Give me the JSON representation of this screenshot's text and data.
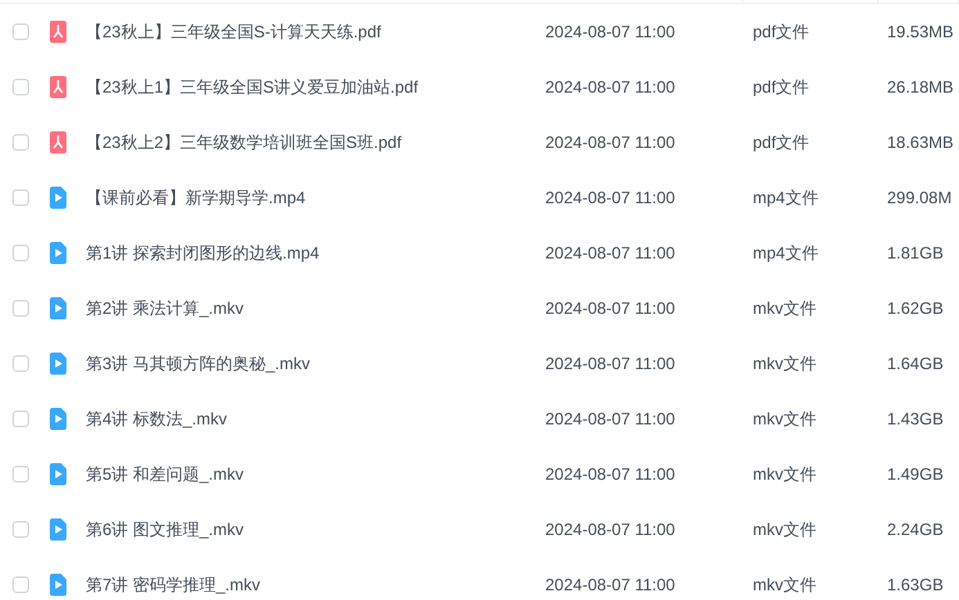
{
  "files": [
    {
      "kind": "pdf",
      "selected": false,
      "name": "【23秋上】三年级全国S-计算天天练.pdf",
      "date": "2024-08-07 11:00",
      "type": "pdf文件",
      "size": "19.53MB"
    },
    {
      "kind": "pdf",
      "selected": false,
      "name": "【23秋上1】三年级全国S讲义爱豆加油站.pdf",
      "date": "2024-08-07 11:00",
      "type": "pdf文件",
      "size": "26.18MB"
    },
    {
      "kind": "pdf",
      "selected": false,
      "name": "【23秋上2】三年级数学培训班全国S班.pdf",
      "date": "2024-08-07 11:00",
      "type": "pdf文件",
      "size": "18.63MB"
    },
    {
      "kind": "video",
      "selected": false,
      "name": "【课前必看】新学期导学.mp4",
      "date": "2024-08-07 11:00",
      "type": "mp4文件",
      "size": "299.08M"
    },
    {
      "kind": "video",
      "selected": false,
      "name": "第1讲 探索封闭图形的边线.mp4",
      "date": "2024-08-07 11:00",
      "type": "mp4文件",
      "size": "1.81GB"
    },
    {
      "kind": "video",
      "selected": false,
      "name": "第2讲 乘法计算_.mkv",
      "date": "2024-08-07 11:00",
      "type": "mkv文件",
      "size": "1.62GB"
    },
    {
      "kind": "video",
      "selected": false,
      "name": "第3讲 马其顿方阵的奥秘_.mkv",
      "date": "2024-08-07 11:00",
      "type": "mkv文件",
      "size": "1.64GB"
    },
    {
      "kind": "video",
      "selected": false,
      "name": "第4讲 标数法_.mkv",
      "date": "2024-08-07 11:00",
      "type": "mkv文件",
      "size": "1.43GB"
    },
    {
      "kind": "video",
      "selected": false,
      "name": "第5讲 和差问题_.mkv",
      "date": "2024-08-07 11:00",
      "type": "mkv文件",
      "size": "1.49GB"
    },
    {
      "kind": "video",
      "selected": false,
      "name": "第6讲 图文推理_.mkv",
      "date": "2024-08-07 11:00",
      "type": "mkv文件",
      "size": "2.24GB"
    },
    {
      "kind": "video",
      "selected": false,
      "name": "第7讲 密码学推理_.mkv",
      "date": "2024-08-07 11:00",
      "type": "mkv文件",
      "size": "1.63GB"
    }
  ]
}
